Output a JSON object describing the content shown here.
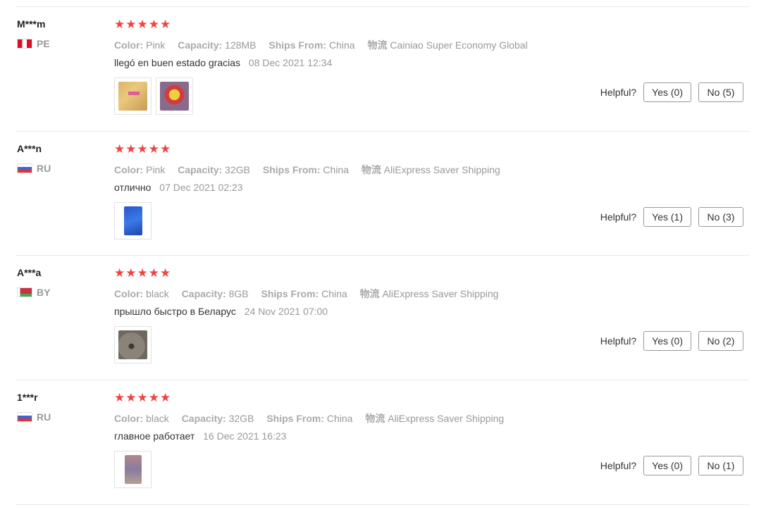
{
  "labels": {
    "color": "Color:",
    "capacity": "Capacity:",
    "ships_from": "Ships From:",
    "logistics": "物流",
    "helpful": "Helpful?"
  },
  "colors": {
    "star": "#f04343",
    "muted": "#999999"
  },
  "reviews": [
    {
      "user": "M***m",
      "country": "PE",
      "flag_icon": "flag-pe-icon",
      "stars": 5,
      "color": "Pink",
      "capacity": "128MB",
      "ships_from": "China",
      "logistics": "Cainiao Super Economy Global",
      "text": "llegó en buen estado gracias",
      "date": "08 Dec 2021 12:34",
      "yes": "Yes (0)",
      "no": "No (5)"
    },
    {
      "user": "A***n",
      "country": "RU",
      "flag_icon": "flag-ru-icon",
      "stars": 5,
      "color": "Pink",
      "capacity": "32GB",
      "ships_from": "China",
      "logistics": "AliExpress Saver Shipping",
      "text": "отлично",
      "date": "07 Dec 2021 02:23",
      "yes": "Yes (1)",
      "no": "No (3)"
    },
    {
      "user": "A***a",
      "country": "BY",
      "flag_icon": "flag-by-icon",
      "stars": 5,
      "color": "black",
      "capacity": "8GB",
      "ships_from": "China",
      "logistics": "AliExpress Saver Shipping",
      "text": "прышло быстро в Беларус",
      "date": "24 Nov 2021 07:00",
      "yes": "Yes (0)",
      "no": "No (2)"
    },
    {
      "user": "1***r",
      "country": "RU",
      "flag_icon": "flag-ru-icon",
      "stars": 5,
      "color": "black",
      "capacity": "32GB",
      "ships_from": "China",
      "logistics": "AliExpress Saver Shipping",
      "text": "главное работает",
      "date": "16 Dec 2021 16:23",
      "yes": "Yes (0)",
      "no": "No (1)"
    }
  ]
}
